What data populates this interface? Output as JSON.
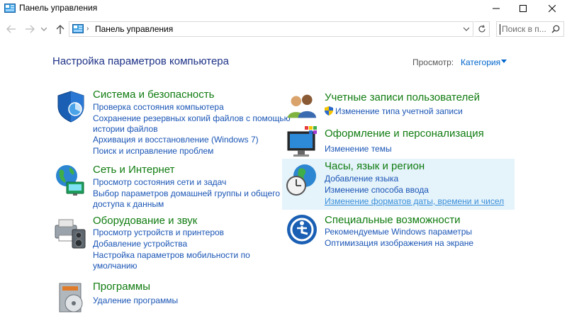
{
  "window": {
    "title": "Панель управления"
  },
  "address": {
    "crumb": "Панель управления",
    "search_placeholder": "Поиск в п..."
  },
  "main": {
    "heading": "Настройка параметров компьютера",
    "view_by_label": "Просмотр:",
    "view_by_value": "Категория"
  },
  "categories": [
    {
      "title": "Система и безопасность",
      "icon": "shield-icon",
      "links": [
        "Проверка состояния компьютера",
        "Сохранение резервных копий файлов с помощью",
        "истории файлов",
        "Архивация и восстановление (Windows 7)",
        "Поиск и исправление проблем"
      ]
    },
    {
      "title": "Сеть и Интернет",
      "icon": "network-globe-icon",
      "links": [
        "Просмотр состояния сети и задач",
        "Выбор параметров домашней группы и общего",
        "доступа к данным"
      ]
    },
    {
      "title": "Оборудование и звук",
      "icon": "printer-speaker-icon",
      "links": [
        "Просмотр устройств и принтеров",
        "Добавление устройства",
        "Настройка параметров мобильности по",
        "умолчанию"
      ]
    },
    {
      "title": "Программы",
      "icon": "programs-disc-icon",
      "links": [
        "Удаление программы"
      ]
    },
    {
      "title": "Учетные записи пользователей",
      "icon": "users-icon",
      "links": [
        "Изменение типа учетной записи"
      ]
    },
    {
      "title": "Оформление и персонализация",
      "icon": "monitor-palette-icon",
      "links": [
        "Изменение темы"
      ]
    },
    {
      "title": "Часы, язык и регион",
      "icon": "clock-globe-icon",
      "links": [
        "Добавление языка",
        "Изменение способа ввода",
        "Изменение форматов даты, времени и чисел"
      ]
    },
    {
      "title": "Специальные возможности",
      "icon": "accessibility-icon",
      "links": [
        "Рекомендуемые Windows параметры",
        "Оптимизация изображения на экране"
      ]
    }
  ],
  "colors": {
    "heading": "#1e3287",
    "category_title": "#107c10",
    "link": "#1a55b5",
    "highlight_bg": "#e5f3fb"
  }
}
